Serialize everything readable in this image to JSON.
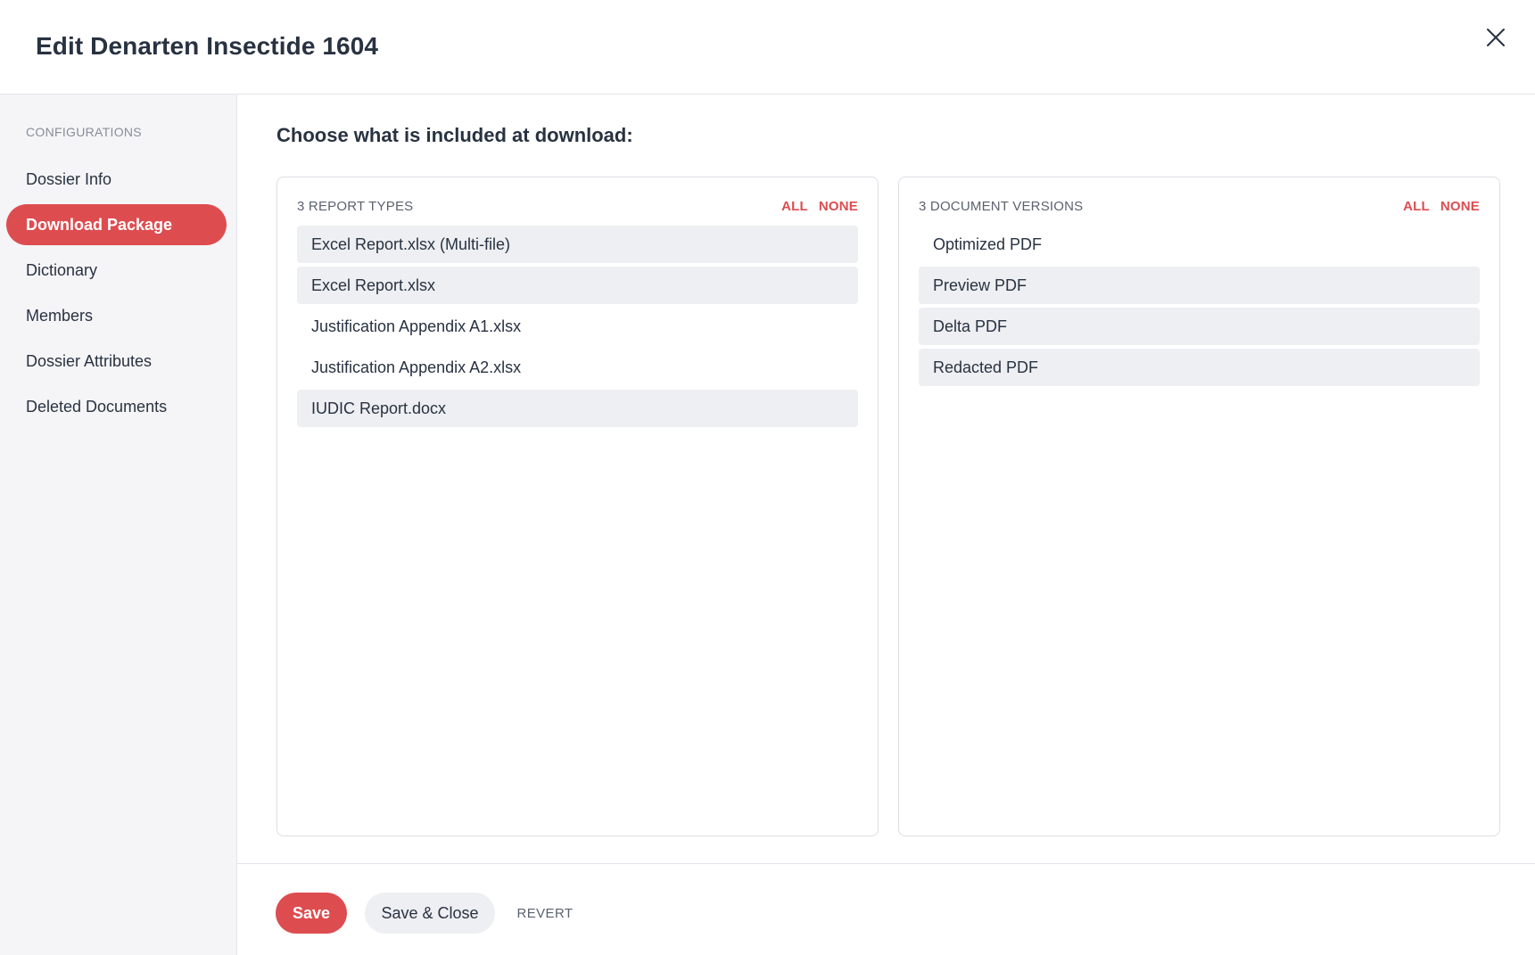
{
  "dialog": {
    "title": "Edit Denarten Insectide 1604"
  },
  "sidebar": {
    "section_label": "CONFIGURATIONS",
    "items": [
      {
        "label": "Dossier Info",
        "active": false
      },
      {
        "label": "Download Package",
        "active": true
      },
      {
        "label": "Dictionary",
        "active": false
      },
      {
        "label": "Members",
        "active": false
      },
      {
        "label": "Dossier Attributes",
        "active": false
      },
      {
        "label": "Deleted Documents",
        "active": false
      }
    ]
  },
  "main": {
    "heading": "Choose what is included at download:",
    "report_types": {
      "title": "3 REPORT TYPES",
      "all_label": "ALL",
      "none_label": "NONE",
      "items": [
        {
          "label": "Excel Report.xlsx (Multi-file)",
          "selected": true
        },
        {
          "label": "Excel Report.xlsx",
          "selected": true
        },
        {
          "label": "Justification Appendix A1.xlsx",
          "selected": false
        },
        {
          "label": "Justification Appendix A2.xlsx",
          "selected": false
        },
        {
          "label": "IUDIC Report.docx",
          "selected": true
        }
      ]
    },
    "document_versions": {
      "title": "3 DOCUMENT VERSIONS",
      "all_label": "ALL",
      "none_label": "NONE",
      "items": [
        {
          "label": "Optimized PDF",
          "selected": false
        },
        {
          "label": "Preview PDF",
          "selected": true
        },
        {
          "label": "Delta PDF",
          "selected": true
        },
        {
          "label": "Redacted PDF",
          "selected": true
        }
      ]
    }
  },
  "footer": {
    "save_label": "Save",
    "save_close_label": "Save & Close",
    "revert_label": "REVERT"
  },
  "colors": {
    "accent": "#dd4d50",
    "selected_bg": "#eeeff2",
    "sidebar_bg": "#f5f5f7",
    "text": "#283241"
  },
  "icons": {
    "close": "close-icon"
  }
}
